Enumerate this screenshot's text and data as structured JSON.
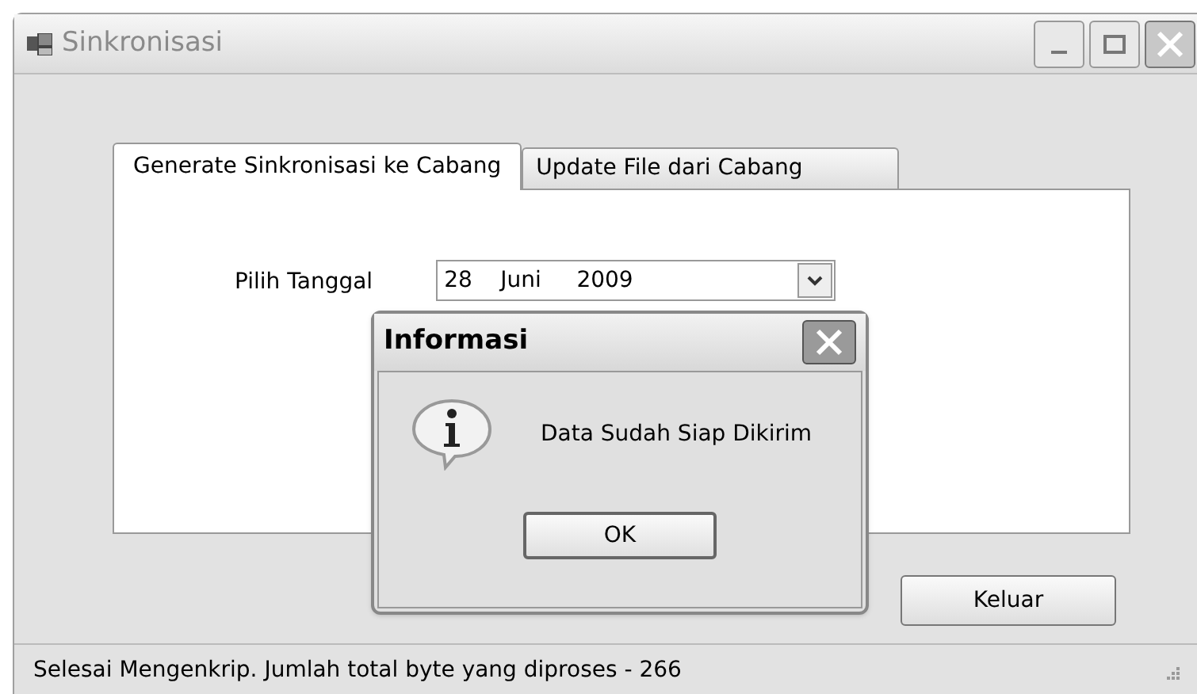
{
  "window": {
    "title": "Sinkronisasi"
  },
  "tabs": [
    {
      "label": "Generate Sinkronisasi ke Cabang",
      "selected": true
    },
    {
      "label": "Update File dari Cabang",
      "selected": false
    }
  ],
  "date_field": {
    "label": "Pilih Tanggal",
    "value": "28    Juni     2009"
  },
  "buttons": [
    "Keluar"
  ],
  "status_bar": "Selesai Mengenkrip. Jumlah total byte yang diproses - 266",
  "dialog": {
    "title": "Informasi",
    "message": "Data Sudah Siap Dikirim",
    "button": "OK"
  }
}
